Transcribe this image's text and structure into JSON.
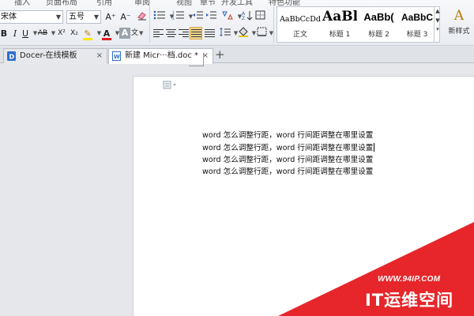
{
  "menu": {
    "items": [
      "插入",
      "页面布局",
      "引用",
      "审阅",
      "视图",
      "章节",
      "开发工具",
      "特色功能"
    ]
  },
  "font": {
    "family": "宋体",
    "size": "五号"
  },
  "toolbar": {
    "grow_font": "A⁺",
    "shrink_font": "A⁻",
    "bold": "B",
    "italic": "I",
    "underline": "U",
    "strikethrough": "AB",
    "superscript": "X²",
    "subscript": "X₂",
    "highlight": "✎",
    "font_color": "A",
    "char_shading": "A",
    "phonetic": "文"
  },
  "styles": {
    "items": [
      {
        "preview": "AaBbCcDd",
        "label": "正文"
      },
      {
        "preview": "AaBl",
        "label": "标题 1"
      },
      {
        "preview": "AaBb(",
        "label": "标题 2"
      },
      {
        "preview": "AaBbC",
        "label": "标题 3"
      }
    ],
    "new_style_glyph": "A",
    "new_style_label": "新样式"
  },
  "tabs": [
    {
      "label": "Docer-在线模板",
      "active": false,
      "icon_color": "#2f6fc9"
    },
    {
      "label": "新建 Micr···档.doc *",
      "active": true,
      "icon_color": "#2f6fc9"
    }
  ],
  "add_tab": "+",
  "tab_close": "×",
  "document": {
    "lines": [
      "word 怎么调整行距，word 行间距调整在哪里设置",
      "word 怎么调整行距，word 行间距调整在哪里设置",
      "word 怎么调整行距，word 行间距调整在哪里设置",
      "word 怎么调整行距，word 行间距调整在哪里设置"
    ]
  },
  "watermark": {
    "url": "WWW.94IP.COM",
    "brand": "IT运维空间",
    "color": "#e6262a"
  },
  "colors": {
    "accent_highlight": "#f6d88f",
    "font_color_bar": "#e02020",
    "highlight_bar": "#ffe800"
  }
}
